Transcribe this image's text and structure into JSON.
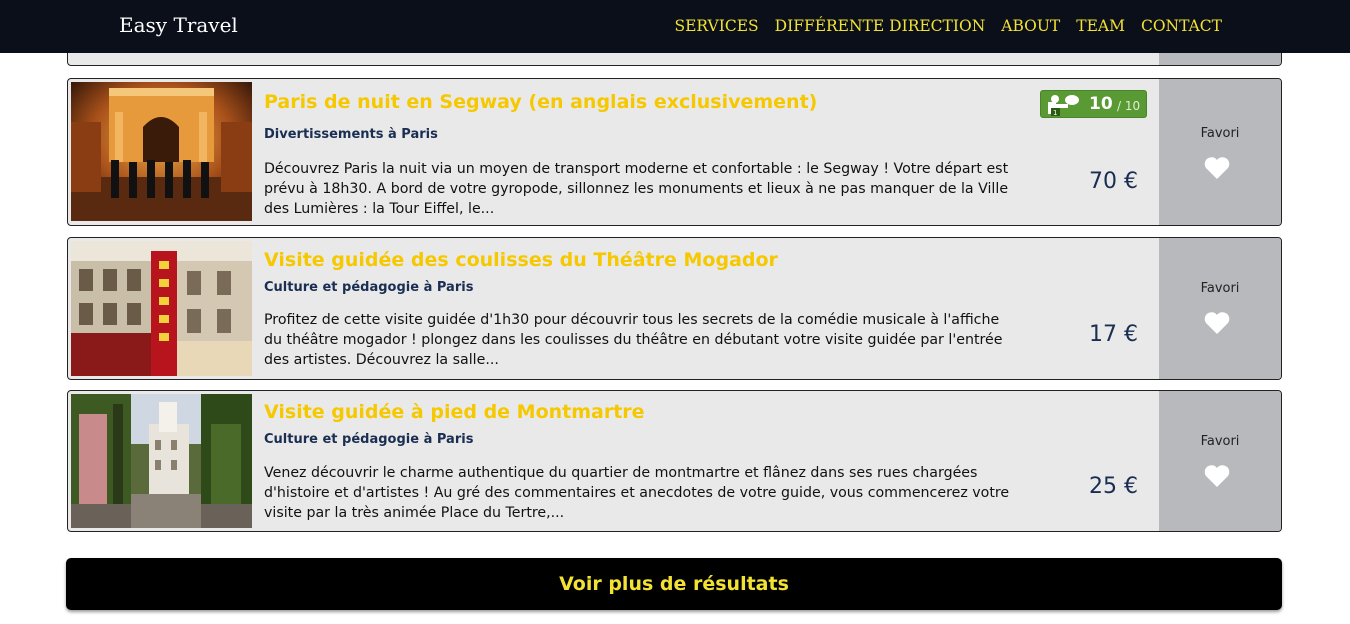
{
  "nav": {
    "brand": "Easy Travel",
    "links": [
      "SERVICES",
      "DIFFÉRENTE DIRECTION",
      "ABOUT",
      "TEAM",
      "CONTACT"
    ]
  },
  "results": [
    {
      "title": "Paris de nuit en Segway (en anglais exclusivement)",
      "category": "Divertissements à Paris",
      "description": "Découvrez Paris la nuit via un moyen de transport  moderne et confortable : le Segway ! Votre départ est prévu à 18h30. A bord de votre gyropode, sillonnez les monuments et lieux à ne pas manquer de la Ville des Lumières : la Tour Eiffel, le...",
      "price": "70 €",
      "favorite_label": "Favori",
      "rating": {
        "score": "10",
        "max": "/ 10"
      },
      "image": "segway-night-paris-photo"
    },
    {
      "title": "Visite guidée des coulisses du Théâtre Mogador",
      "category": "Culture et pédagogie à Paris",
      "description": "Profitez de cette visite guidée d'1h30 pour découvrir tous les secrets de la comédie musicale à l'affiche du théâtre mogador !   plongez dans les coulisses du théâtre en débutant votre visite guidée par l'entrée des artistes. Découvrez la salle...",
      "price": "17 €",
      "favorite_label": "Favori",
      "image": "theatre-mogador-photo"
    },
    {
      "title": "Visite guidée à pied de Montmartre",
      "category": "Culture et pédagogie à Paris",
      "description": "Venez découvrir le charme authentique du quartier de montmartre et flânez dans ses rues chargées d'histoire et d'artistes ! Au gré des commentaires et anecdotes de votre guide, vous commencerez votre visite par la très animée Place du Tertre,...",
      "price": "25 €",
      "favorite_label": "Favori",
      "image": "montmartre-street-photo"
    }
  ],
  "more_button": "Voir plus de résultats",
  "colors": {
    "navbar": "#0a0f1a",
    "accent_yellow": "#f2e233",
    "title_yellow": "#f5c800",
    "card_bg": "#e9e9e9",
    "favorite_panel": "#b8b9bc",
    "price_navy": "#1a2e52",
    "rating_green": "#5a9a35"
  }
}
